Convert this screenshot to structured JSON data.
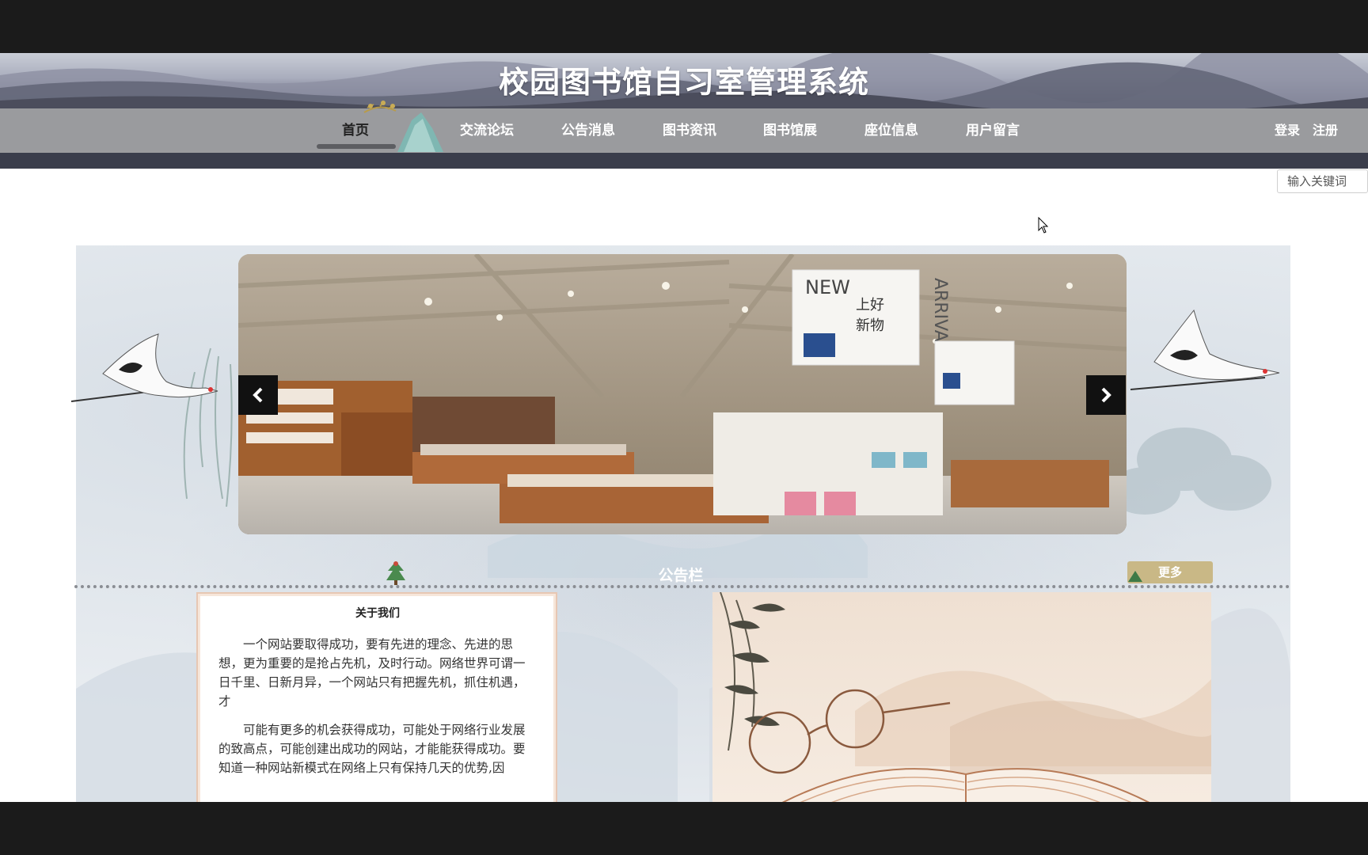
{
  "site": {
    "title": "校园图书馆自习室管理系统"
  },
  "nav": {
    "items": [
      {
        "label": "首页",
        "active": true
      },
      {
        "label": "交流论坛",
        "active": false
      },
      {
        "label": "公告消息",
        "active": false
      },
      {
        "label": "图书资讯",
        "active": false
      },
      {
        "label": "图书馆展",
        "active": false
      },
      {
        "label": "座位信息",
        "active": false
      },
      {
        "label": "用户留言",
        "active": false
      }
    ],
    "login_label": "登录",
    "register_label": "注册"
  },
  "search": {
    "placeholder": "输入关键词"
  },
  "carousel": {
    "prev_icon": "chevron-left-icon",
    "next_icon": "chevron-right-icon",
    "sign_text_1": "NEW",
    "sign_text_2": "ARRIVALS",
    "sign_text_3": "上好",
    "sign_text_4": "新物"
  },
  "notice": {
    "title": "公告栏",
    "more_label": "更多"
  },
  "about": {
    "title": "关于我们",
    "paragraphs": [
      "一个网站要取得成功，要有先进的理念、先进的思想，更为重要的是抢占先机，及时行动。网络世界可谓一日千里、日新月异，一个网站只有把握先机，抓住机遇，才",
      "可能有更多的机会获得成功，可能处于网络行业发展的致高点，可能创建出成功的网站，才能能获得成功。要知道一种网站新模式在网络上只有保持几天的优势,因"
    ]
  },
  "colors": {
    "nav_bg": "#9a9b9e",
    "nav_strip": "#3a3d4b",
    "more_button": "#c9b886",
    "card_border": "#e7c7b3"
  }
}
